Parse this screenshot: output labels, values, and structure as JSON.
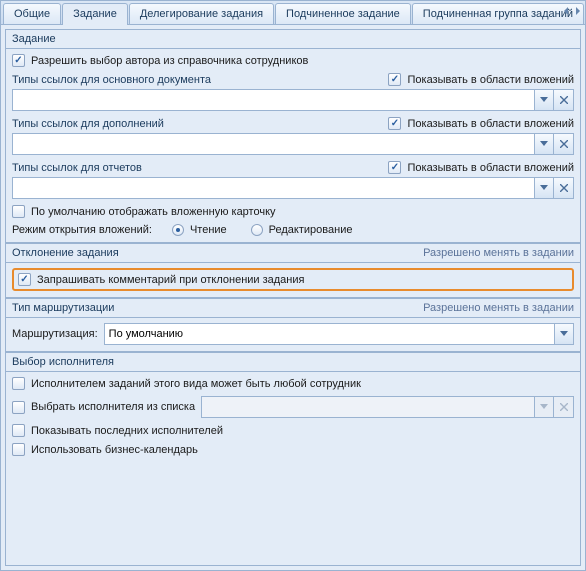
{
  "tabs": [
    {
      "label": "Общие",
      "active": false
    },
    {
      "label": "Задание",
      "active": true
    },
    {
      "label": "Делегирование задания",
      "active": false
    },
    {
      "label": "Подчиненное задание",
      "active": false
    },
    {
      "label": "Подчиненная группа заданий",
      "active": false
    }
  ],
  "sections": {
    "task": {
      "title": "Задание",
      "allow_author_from_directory": {
        "label": "Разрешить выбор автора из справочника сотрудников",
        "checked": true
      },
      "link_types_main": {
        "title": "Типы ссылок для основного документа",
        "show_in_att": {
          "label": "Показывать в области вложений",
          "checked": true
        },
        "value": ""
      },
      "link_types_extra": {
        "title": "Типы ссылок для дополнений",
        "show_in_att": {
          "label": "Показывать в области вложений",
          "checked": true
        },
        "value": ""
      },
      "link_types_reports": {
        "title": "Типы ссылок для отчетов",
        "show_in_att": {
          "label": "Показывать в области вложений",
          "checked": true
        },
        "value": ""
      },
      "show_nested_card": {
        "label": "По умолчанию отображать вложенную карточку",
        "checked": false
      },
      "open_mode": {
        "label": "Режим открытия вложений:",
        "options": {
          "read": "Чтение",
          "edit": "Редактирование"
        },
        "selected": "read"
      }
    },
    "decline": {
      "title": "Отклонение задания",
      "hint": "Разрешено менять в задании",
      "ask_comment": {
        "label": "Запрашивать комментарий при отклонении задания",
        "checked": true
      }
    },
    "routing": {
      "title": "Тип маршрутизации",
      "hint": "Разрешено менять в задании",
      "route_label": "Маршрутизация:",
      "route_value": "По умолчанию"
    },
    "assignee": {
      "title": "Выбор исполнителя",
      "any_employee": {
        "label": "Исполнителем заданий этого вида может быть любой сотрудник",
        "checked": false
      },
      "from_list": {
        "label": "Выбрать исполнителя из списка",
        "checked": false,
        "value": ""
      },
      "show_recent": {
        "label": "Показывать последних исполнителей",
        "checked": false
      },
      "use_calendar": {
        "label": "Использовать бизнес-календарь",
        "checked": false
      }
    }
  }
}
